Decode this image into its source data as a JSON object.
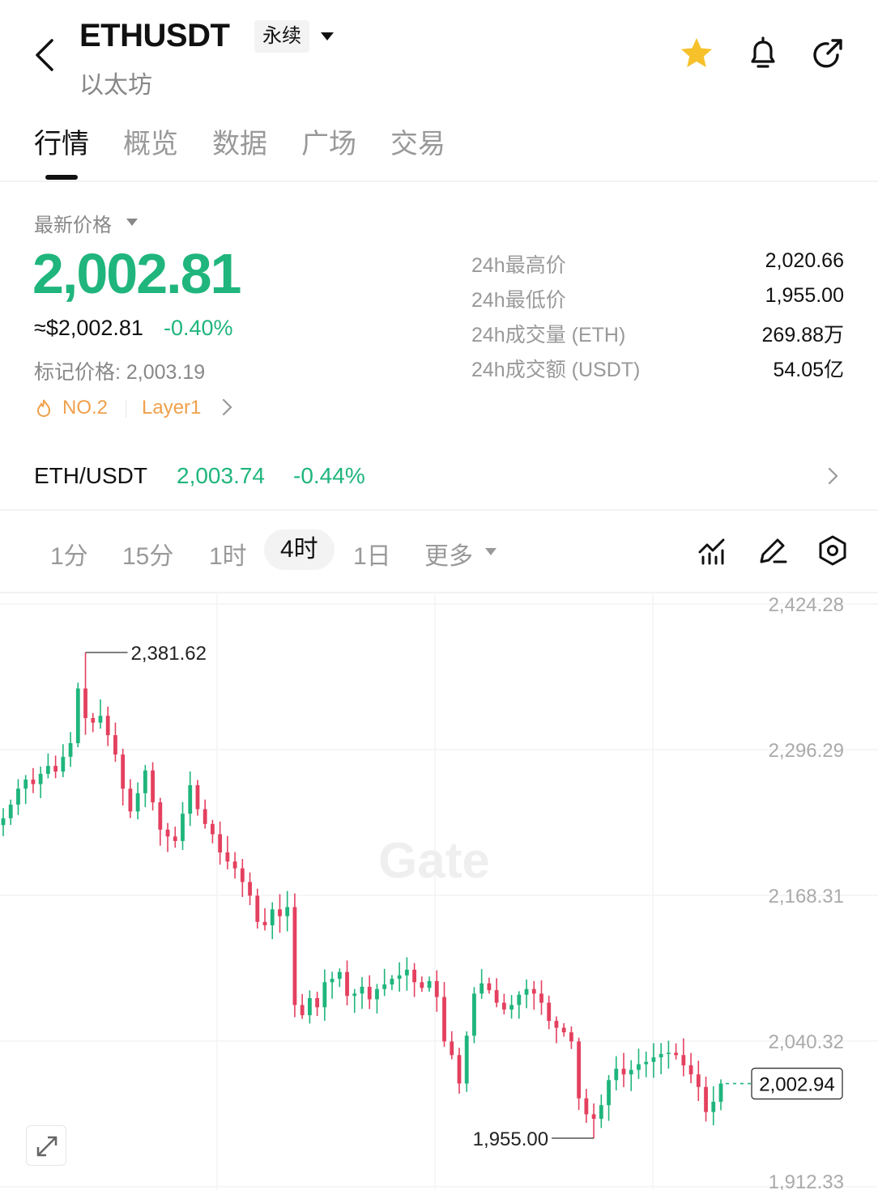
{
  "header": {
    "symbol": "ETHUSDT",
    "contract_type": "永续",
    "name": "以太坊"
  },
  "tabs": [
    "行情",
    "概览",
    "数据",
    "广场",
    "交易"
  ],
  "active_tab": 0,
  "ticker": {
    "latest_label": "最新价格",
    "price": "2,002.81",
    "usd_approx": "≈$2,002.81",
    "change_pct": "-0.40%",
    "mark_price": "标记价格: 2,003.19",
    "rank": "NO.2",
    "tag": "Layer1",
    "stats": [
      {
        "label": "24h最高价",
        "value": "2,020.66"
      },
      {
        "label": "24h最低价",
        "value": "1,955.00"
      },
      {
        "label": "24h成交量 (ETH)",
        "value": "269.88万"
      },
      {
        "label": "24h成交额 (USDT)",
        "value": "54.05亿"
      }
    ],
    "up_color": "#1fb57c",
    "down_color": "#e4405f"
  },
  "spot": {
    "pair": "ETH/USDT",
    "price": "2,003.74",
    "change_pct": "-0.44%"
  },
  "intervals": [
    "1分",
    "15分",
    "1时",
    "4时",
    "1日",
    "更多"
  ],
  "active_interval": "4时",
  "chart_data": {
    "type": "candlestick",
    "y_ticks": [
      "2,424.28",
      "2,296.29",
      "2,168.31",
      "2,040.32",
      "1,912.33"
    ],
    "ylim": [
      1912.33,
      2424.28
    ],
    "high_marker": "2,381.62",
    "low_marker": "1,955.00",
    "last_price_label": "2,002.94",
    "watermark": "Gate",
    "closes": [
      2236,
      2248,
      2262,
      2270,
      2266,
      2275,
      2282,
      2277,
      2290,
      2302,
      2350,
      2324,
      2320,
      2326,
      2309,
      2292,
      2262,
      2242,
      2258,
      2278,
      2250,
      2226,
      2220,
      2216,
      2240,
      2265,
      2244,
      2231,
      2222,
      2206,
      2198,
      2192,
      2180,
      2168,
      2145,
      2142,
      2156,
      2150,
      2158,
      2072,
      2063,
      2078,
      2070,
      2092,
      2095,
      2101,
      2080,
      2082,
      2088,
      2077,
      2086,
      2090,
      2095,
      2098,
      2103,
      2092,
      2087,
      2093,
      2079,
      2040,
      2028,
      2003,
      2045,
      2082,
      2091,
      2085,
      2074,
      2068,
      2072,
      2081,
      2086,
      2082,
      2074,
      2058,
      2052,
      2048,
      2040,
      1990,
      1976,
      1972,
      1984,
      2006,
      2016,
      2011,
      2015,
      2020,
      2022,
      2026,
      2029,
      2030,
      2028,
      2019,
      2011,
      2000,
      1978,
      1987,
      2003
    ]
  }
}
